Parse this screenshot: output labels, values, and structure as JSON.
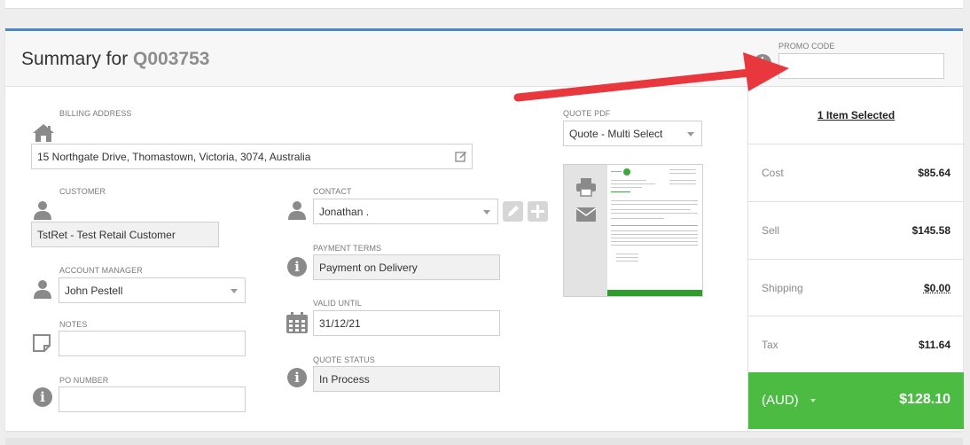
{
  "header": {
    "title_prefix": "Summary for",
    "quote_number": "Q003753",
    "promo_label": "PROMO CODE",
    "promo_value": ""
  },
  "billing": {
    "label": "BILLING ADDRESS",
    "address": "15 Northgate Drive, Thomastown, Victoria, 3074, Australia"
  },
  "customer": {
    "label": "CUSTOMER",
    "value": "TstRet - Test Retail Customer"
  },
  "account_manager": {
    "label": "ACCOUNT MANAGER",
    "value": "John Pestell"
  },
  "notes": {
    "label": "NOTES",
    "value": ""
  },
  "po_number": {
    "label": "PO NUMBER",
    "value": ""
  },
  "contact": {
    "label": "CONTACT",
    "value": "Jonathan ."
  },
  "payment_terms": {
    "label": "PAYMENT TERMS",
    "value": "Payment on Delivery"
  },
  "valid_until": {
    "label": "VALID UNTIL",
    "value": "31/12/21"
  },
  "quote_status": {
    "label": "QUOTE STATUS",
    "value": "In Process"
  },
  "quote_pdf": {
    "label": "QUOTE PDF",
    "value": "Quote - Multi Select"
  },
  "summary": {
    "items_selected": "1 Item Selected",
    "rows": [
      {
        "label": "Cost",
        "value": "$85.64"
      },
      {
        "label": "Sell",
        "value": "$145.58"
      },
      {
        "label": "Shipping",
        "value": "$0.00"
      },
      {
        "label": "Tax",
        "value": "$11.64"
      }
    ],
    "currency": "(AUD)",
    "total": "$128.10"
  },
  "colors": {
    "accent_blue": "#4a86c8",
    "total_green": "#4cbb42",
    "arrow_red": "#e8383d"
  },
  "icons": [
    "home-icon",
    "edit-icon",
    "user-icon",
    "info-icon",
    "note-icon",
    "calendar-icon",
    "pencil-icon",
    "plus-icon",
    "print-icon",
    "envelope-icon",
    "arrow-annotation"
  ]
}
